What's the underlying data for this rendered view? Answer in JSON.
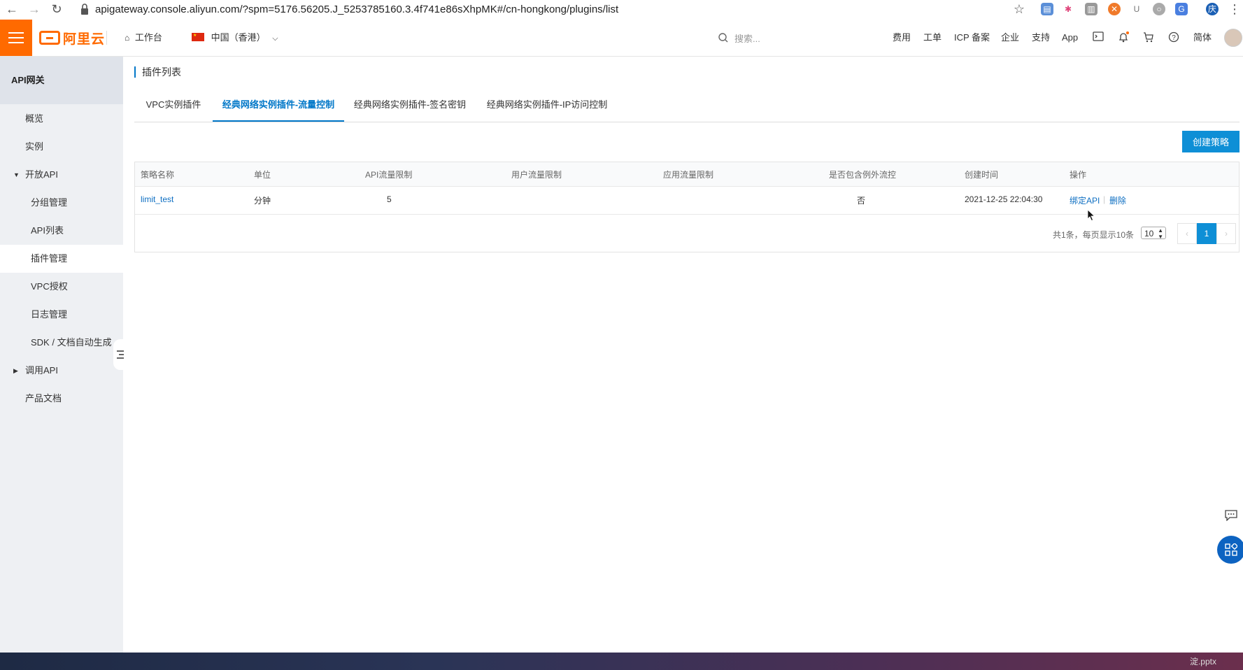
{
  "browser": {
    "url": "apigateway.console.aliyun.com/?spm=5176.56205.J_5253785160.3.4f741e86sXhpMK#/cn-hongkong/plugins/list"
  },
  "topbar": {
    "logo": "阿里云",
    "workbench": "工作台",
    "region": "中国（香港）",
    "search_placeholder": "搜索...",
    "links": [
      "费用",
      "工单",
      "ICP 备案",
      "企业",
      "支持",
      "App"
    ],
    "lang": "简体"
  },
  "sidebar": {
    "title": "API网关",
    "items": [
      {
        "label": "概览"
      },
      {
        "label": "实例"
      },
      {
        "label": "开放API"
      },
      {
        "label": "分组管理"
      },
      {
        "label": "API列表"
      },
      {
        "label": "插件管理"
      },
      {
        "label": "VPC授权"
      },
      {
        "label": "日志管理"
      },
      {
        "label": "SDK / 文档自动生成"
      },
      {
        "label": "调用API"
      },
      {
        "label": "产品文档"
      }
    ]
  },
  "page": {
    "title": "插件列表",
    "tabs": [
      {
        "label": "VPC实例插件"
      },
      {
        "label": "经典网络实例插件-流量控制"
      },
      {
        "label": "经典网络实例插件-签名密钥"
      },
      {
        "label": "经典网络实例插件-IP访问控制"
      }
    ],
    "create_button": "创建策略"
  },
  "table": {
    "headers": [
      "策略名称",
      "单位",
      "API流量限制",
      "用户流量限制",
      "应用流量限制",
      "是否包含例外流控",
      "创建时间",
      "操作"
    ],
    "rows": [
      {
        "name": "limit_test",
        "unit": "分钟",
        "api_limit": "5",
        "user_limit": "",
        "app_limit": "",
        "exception": "否",
        "created": "2021-12-25 22:04:30",
        "action_bind": "绑定API",
        "action_delete": "删除"
      }
    ]
  },
  "pagination": {
    "summary": "共1条，每页显示10条",
    "page_size": "10",
    "prev": "‹",
    "current": "1",
    "next": "›"
  },
  "desktop": {
    "taskbar_text": "淀.pptx"
  },
  "colors": {
    "brand": "#ff6a00",
    "primary": "#0e8fd6",
    "link": "#0e6fc2"
  }
}
